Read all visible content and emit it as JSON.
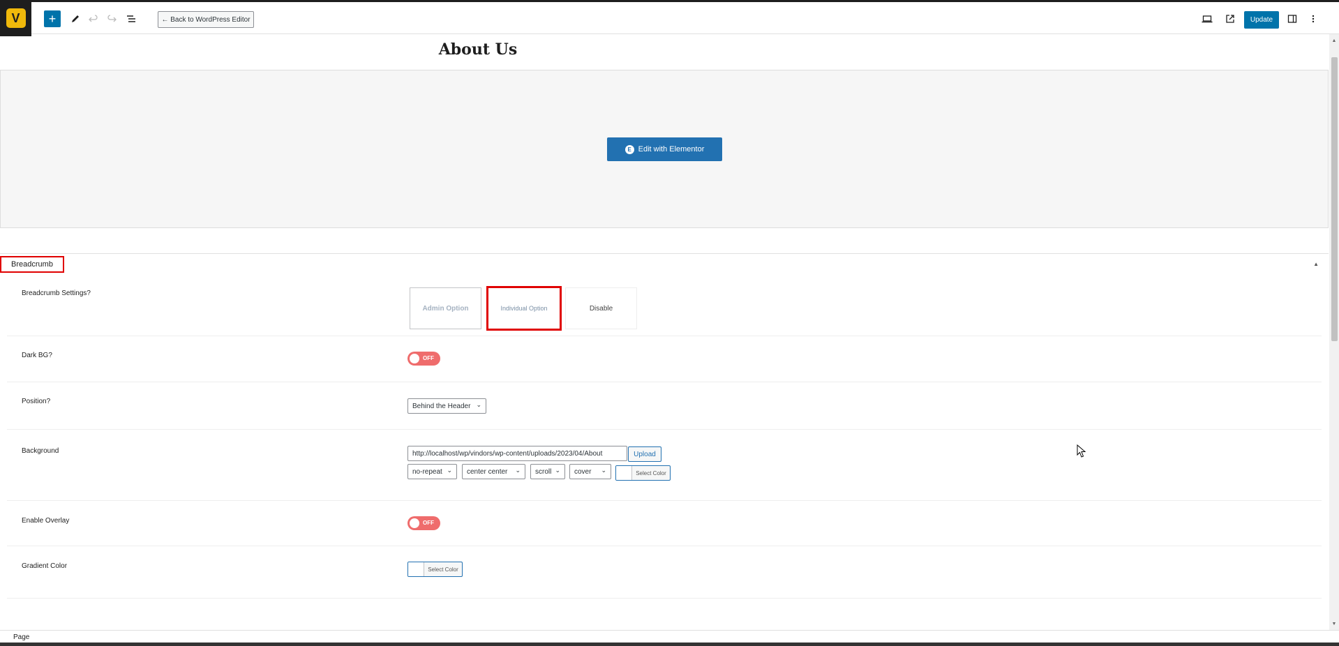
{
  "app": {
    "logo_letter": "V"
  },
  "toolbar": {
    "add_icon": "plus-icon",
    "add_symbol": "+",
    "tools_icon": "pencil-icon",
    "undo_icon": "undo-icon",
    "redo_icon": "redo-icon",
    "outline_icon": "list-view-icon",
    "back_label": "← Back to WordPress Editor",
    "preview_icon": "laptop-icon",
    "view_icon": "external-link-icon",
    "update_label": "Update",
    "settings_icon": "sidebar-icon",
    "more_icon": "kebab-icon",
    "accent": "#0073aa"
  },
  "page": {
    "title": "About Us",
    "elementor_button": "Edit with Elementor",
    "elementor_icon_letter": "E"
  },
  "breadcrumb_panel": {
    "title": "Breadcrumb",
    "settings": {
      "label": "Breadcrumb Settings?",
      "options": [
        "Admin Option",
        "Individual Option",
        "Disable"
      ],
      "selected": "Individual Option"
    },
    "dark_bg": {
      "label": "Dark BG?",
      "state": "OFF"
    },
    "position": {
      "label": "Position?",
      "value": "Behind the Header"
    },
    "background": {
      "label": "Background",
      "url": "http://localhost/wp/vindors/wp-content/uploads/2023/04/About",
      "upload_label": "Upload",
      "repeat": "no-repeat",
      "position": "center center",
      "attachment": "scroll",
      "size": "cover",
      "color_label": "Select Color"
    },
    "overlay": {
      "label": "Enable Overlay",
      "state": "OFF"
    },
    "gradient": {
      "label": "Gradient Color",
      "color_label": "Select Color"
    }
  },
  "footer": {
    "breadcrumb": "Page"
  },
  "colors": {
    "highlight": "#e00000",
    "toggle_off": "#ef6c6c",
    "elementor_blue": "#2271b1"
  }
}
